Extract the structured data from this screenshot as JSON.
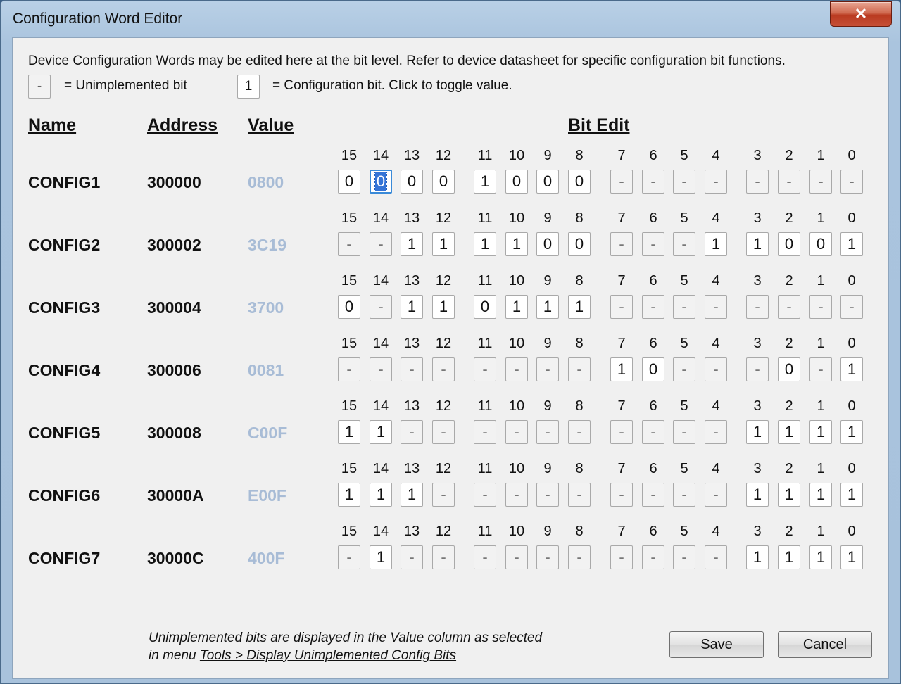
{
  "window": {
    "title": "Configuration Word Editor",
    "close_label": "✕"
  },
  "description": "Device Configuration Words may be edited here at the bit level.  Refer to device datasheet for specific configuration bit functions.",
  "legend": {
    "unimpl_symbol": "-",
    "unimpl_text": "= Unimplemented bit",
    "impl_symbol": "1",
    "impl_text": "= Configuration bit.  Click to toggle value."
  },
  "headers": {
    "name": "Name",
    "address": "Address",
    "value": "Value",
    "bit_edit": "Bit Edit"
  },
  "bit_numbers": [
    "15",
    "14",
    "13",
    "12",
    "11",
    "10",
    "9",
    "8",
    "7",
    "6",
    "5",
    "4",
    "3",
    "2",
    "1",
    "0"
  ],
  "rows": [
    {
      "name": "CONFIG1",
      "address": "300000",
      "value": "0800",
      "bits": [
        "0",
        "0",
        "0",
        "0",
        "1",
        "0",
        "0",
        "0",
        "-",
        "-",
        "-",
        "-",
        "-",
        "-",
        "-",
        "-"
      ]
    },
    {
      "name": "CONFIG2",
      "address": "300002",
      "value": "3C19",
      "bits": [
        "-",
        "-",
        "1",
        "1",
        "1",
        "1",
        "0",
        "0",
        "-",
        "-",
        "-",
        "1",
        "1",
        "0",
        "0",
        "1"
      ]
    },
    {
      "name": "CONFIG3",
      "address": "300004",
      "value": "3700",
      "bits": [
        "0",
        "-",
        "1",
        "1",
        "0",
        "1",
        "1",
        "1",
        "-",
        "-",
        "-",
        "-",
        "-",
        "-",
        "-",
        "-"
      ]
    },
    {
      "name": "CONFIG4",
      "address": "300006",
      "value": "0081",
      "bits": [
        "-",
        "-",
        "-",
        "-",
        "-",
        "-",
        "-",
        "-",
        "1",
        "0",
        "-",
        "-",
        "-",
        "0",
        "-",
        "1"
      ]
    },
    {
      "name": "CONFIG5",
      "address": "300008",
      "value": "C00F",
      "bits": [
        "1",
        "1",
        "-",
        "-",
        "-",
        "-",
        "-",
        "-",
        "-",
        "-",
        "-",
        "-",
        "1",
        "1",
        "1",
        "1"
      ]
    },
    {
      "name": "CONFIG6",
      "address": "30000A",
      "value": "E00F",
      "bits": [
        "1",
        "1",
        "1",
        "-",
        "-",
        "-",
        "-",
        "-",
        "-",
        "-",
        "-",
        "-",
        "1",
        "1",
        "1",
        "1"
      ]
    },
    {
      "name": "CONFIG7",
      "address": "30000C",
      "value": "400F",
      "bits": [
        "-",
        "1",
        "-",
        "-",
        "-",
        "-",
        "-",
        "-",
        "-",
        "-",
        "-",
        "-",
        "1",
        "1",
        "1",
        "1"
      ]
    }
  ],
  "note": {
    "line1": "Unimplemented bits are displayed in the Value column as selected",
    "line2_prefix": "in menu ",
    "line2_link": "Tools > Display Unimplemented Config Bits"
  },
  "buttons": {
    "save": "Save",
    "cancel": "Cancel"
  }
}
